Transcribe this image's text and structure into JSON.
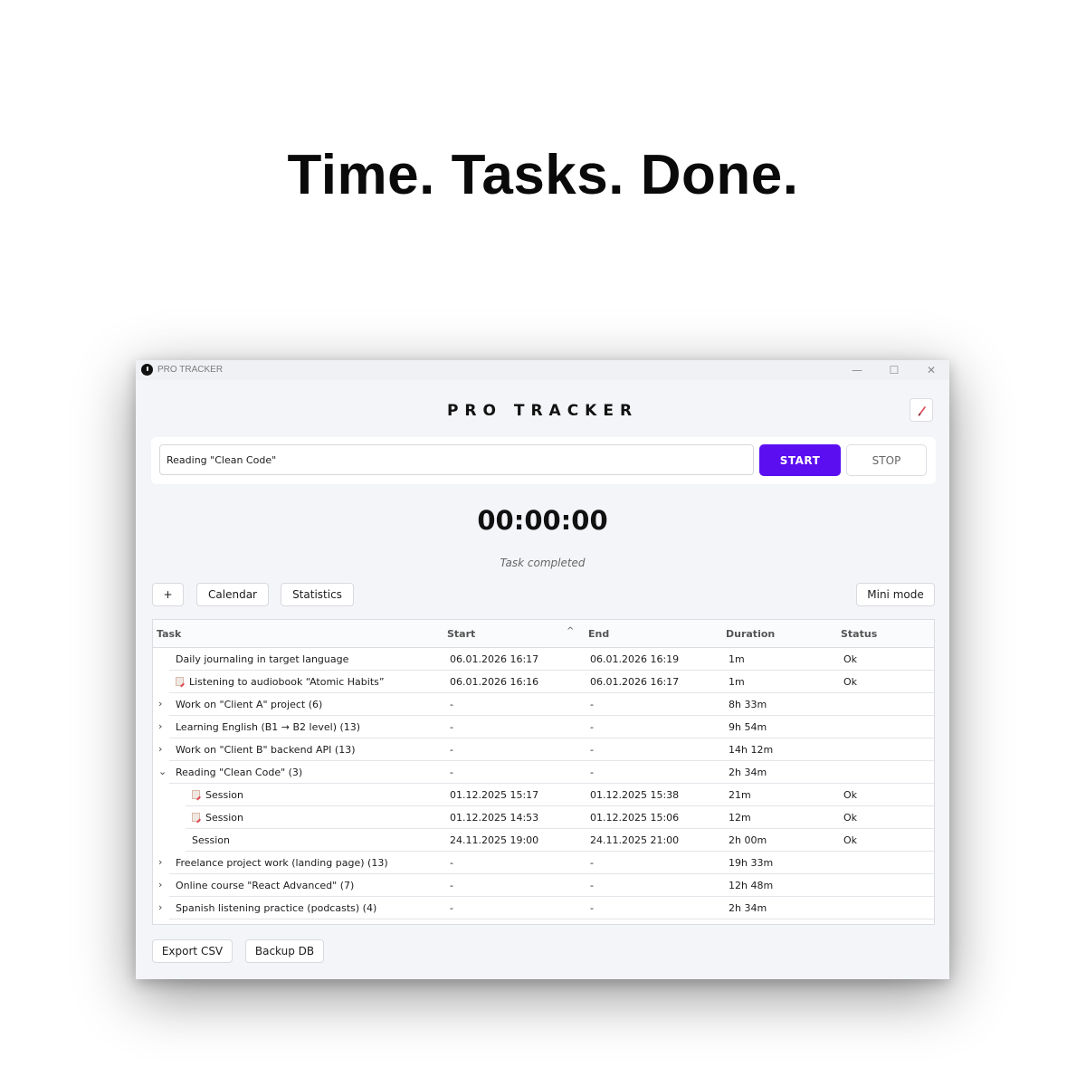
{
  "headline": "Time. Tasks. Done.",
  "window": {
    "title": "PRO TRACKER",
    "controls": {
      "minimize": "—",
      "maximize": "☐",
      "close": "✕"
    }
  },
  "app_title": "PRO TRACKER",
  "theme_icon": "pen-icon",
  "task_input": {
    "value": "Reading \"Clean Code\""
  },
  "buttons": {
    "start": "START",
    "stop": "STOP"
  },
  "timer": "00:00:00",
  "status": "Task completed",
  "toolbar": {
    "add": "+",
    "calendar": "Calendar",
    "statistics": "Statistics",
    "mini_mode": "Mini mode"
  },
  "table": {
    "headers": {
      "task": "Task",
      "start": "Start",
      "end": "End",
      "duration": "Duration",
      "status": "Status"
    },
    "sort_indicator": "^",
    "rows": [
      {
        "task": "Daily journaling in target language",
        "start": "06.01.2026 16:17",
        "end": "06.01.2026 16:19",
        "duration": "1m",
        "status": "Ok",
        "level": 0,
        "chevron": "",
        "icon": false
      },
      {
        "task": "Listening to audiobook “Atomic Habits”",
        "start": "06.01.2026 16:16",
        "end": "06.01.2026 16:17",
        "duration": "1m",
        "status": "Ok",
        "level": 0,
        "chevron": "",
        "icon": true
      },
      {
        "task": "Work on \"Client A\" project (6)",
        "start": "-",
        "end": "-",
        "duration": "8h 33m",
        "status": "",
        "level": 0,
        "chevron": "›",
        "icon": false
      },
      {
        "task": "Learning English (B1 → B2 level) (13)",
        "start": "-",
        "end": "-",
        "duration": "9h 54m",
        "status": "",
        "level": 0,
        "chevron": "›",
        "icon": false
      },
      {
        "task": "Work on \"Client B\" backend API (13)",
        "start": "-",
        "end": "-",
        "duration": "14h 12m",
        "status": "",
        "level": 0,
        "chevron": "›",
        "icon": false
      },
      {
        "task": "Reading \"Clean Code\" (3)",
        "start": "-",
        "end": "-",
        "duration": "2h 34m",
        "status": "",
        "level": 0,
        "chevron": "⌄",
        "icon": false
      },
      {
        "task": "Session",
        "start": "01.12.2025 15:17",
        "end": "01.12.2025 15:38",
        "duration": "21m",
        "status": "Ok",
        "level": 1,
        "chevron": "",
        "icon": true
      },
      {
        "task": "Session",
        "start": "01.12.2025 14:53",
        "end": "01.12.2025 15:06",
        "duration": "12m",
        "status": "Ok",
        "level": 1,
        "chevron": "",
        "icon": true
      },
      {
        "task": "Session",
        "start": "24.11.2025 19:00",
        "end": "24.11.2025 21:00",
        "duration": "2h 00m",
        "status": "Ok",
        "level": 1,
        "chevron": "",
        "icon": false
      },
      {
        "task": "Freelance project work (landing page) (13)",
        "start": "-",
        "end": "-",
        "duration": "19h 33m",
        "status": "",
        "level": 0,
        "chevron": "›",
        "icon": false
      },
      {
        "task": "Online course \"React Advanced\" (7)",
        "start": "-",
        "end": "-",
        "duration": "12h 48m",
        "status": "",
        "level": 0,
        "chevron": "›",
        "icon": false
      },
      {
        "task": "Spanish listening practice (podcasts) (4)",
        "start": "-",
        "end": "-",
        "duration": "2h 34m",
        "status": "",
        "level": 0,
        "chevron": "›",
        "icon": false
      }
    ]
  },
  "bottom": {
    "export": "Export CSV",
    "backup": "Backup DB"
  },
  "colors": {
    "accent": "#5b0ff0",
    "window_bg": "#f4f5f8"
  }
}
